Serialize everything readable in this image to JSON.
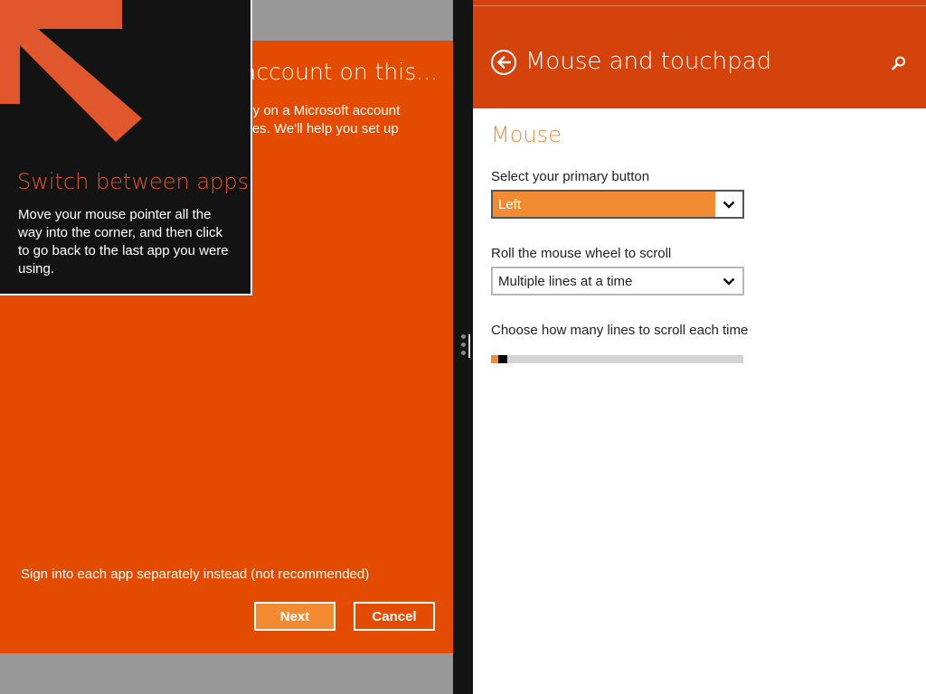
{
  "left_app": {
    "dialog_title": "account on this...",
    "description_lines": [
      "ely on a Microsoft account",
      "ices. We'll help you set up"
    ],
    "separate_link": "Sign into each app separately instead (not recommended)",
    "next_label": "Next",
    "cancel_label": "Cancel"
  },
  "tip": {
    "icon": "corner-arrow-icon",
    "title": "Switch between apps",
    "body_lines": [
      "Move your mouse pointer all the",
      "way into the corner, and then click",
      "to go back to the last app you were",
      "using."
    ]
  },
  "settings": {
    "header": {
      "back_icon": "back-arrow-icon",
      "title": "Mouse and touchpad",
      "search_icon": "search-icon"
    },
    "section_title": "Mouse",
    "primary_button": {
      "label": "Select your primary button",
      "value": "Left"
    },
    "wheel": {
      "label": "Roll the mouse wheel to scroll",
      "value": "Multiple lines at a time"
    },
    "lines": {
      "label": "Choose how many lines to scroll each time",
      "value_fraction": 0.03
    }
  },
  "colors": {
    "dialog_orange": "#e34c00",
    "header_orange": "#d3430b",
    "accent_orange": "#f08a3c",
    "selected_orange": "#f38b32",
    "tip_title": "#e0572e"
  }
}
